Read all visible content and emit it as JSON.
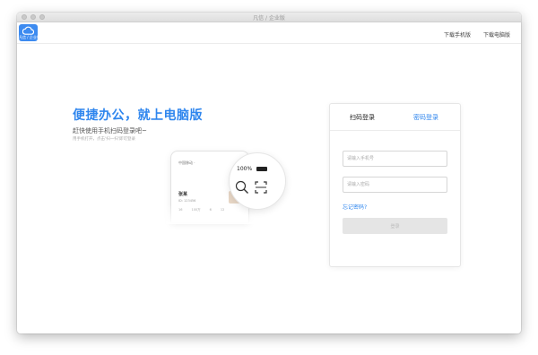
{
  "window": {
    "title": "凡信 / 企业版"
  },
  "logo": {
    "label": "凡信 / 企业版"
  },
  "header": {
    "links": [
      "下载手机版",
      "下载电脑版"
    ]
  },
  "hero": {
    "title": "便捷办公，就上电脑版",
    "subtitle": "赶快使用手机扫码登录吧~",
    "note": "用手机打开，点击'扫一扫'即可登录"
  },
  "phone": {
    "status": "中国移动 ·",
    "zoom_text": "100%",
    "profile_name": "张某",
    "profile_sub": "ID: 123456",
    "stats": [
      "16",
      "100万",
      "6",
      "12"
    ]
  },
  "login": {
    "tabs": [
      "扫码登录",
      "密码登录"
    ],
    "phone_placeholder": "请输入手机号",
    "password_placeholder": "请输入密码",
    "forgot": "忘记密码?",
    "submit": "登录"
  },
  "colors": {
    "accent": "#2f86ee",
    "logo_bg": "#3d8bf0"
  }
}
